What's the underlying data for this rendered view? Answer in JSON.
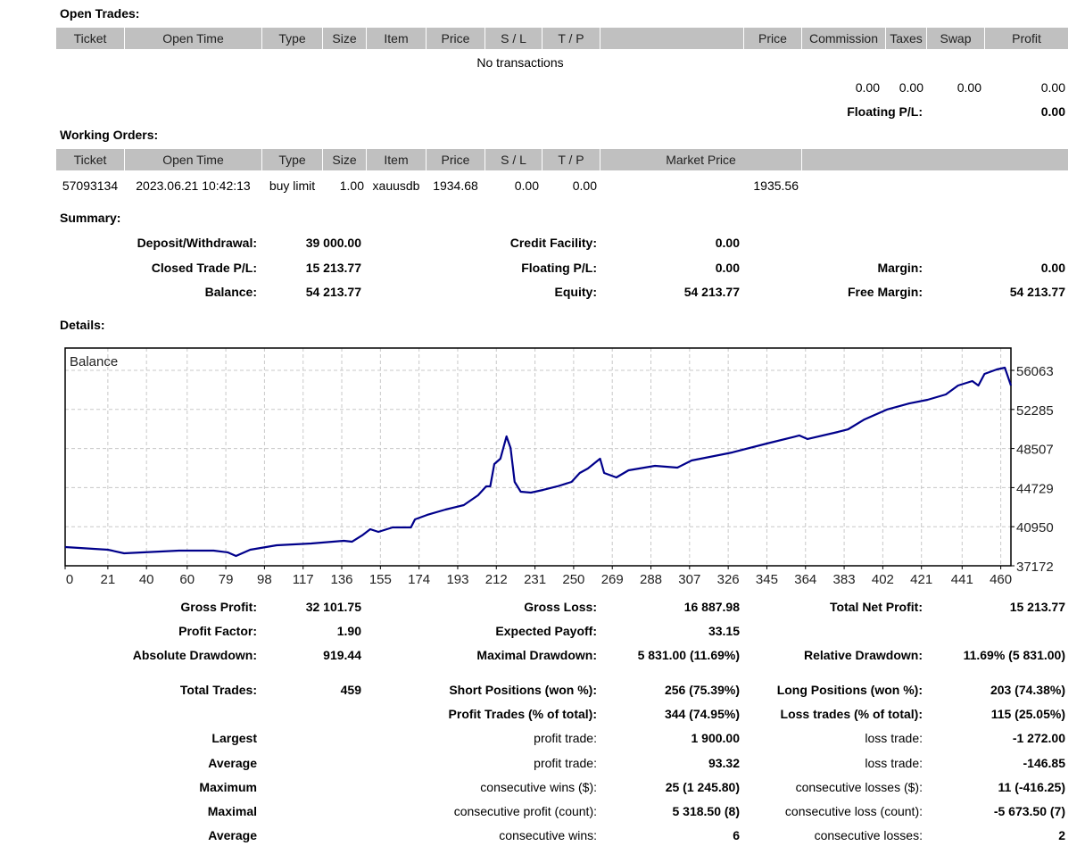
{
  "open_trades": {
    "title": "Open Trades:",
    "headers": [
      "Ticket",
      "Open Time",
      "Type",
      "Size",
      "Item",
      "Price",
      "S / L",
      "T / P",
      "",
      "Price",
      "Commission",
      "Taxes",
      "Swap",
      "Profit"
    ],
    "empty_text": "No transactions",
    "totals": {
      "commission": "0.00",
      "taxes": "0.00",
      "swap": "0.00",
      "profit": "0.00"
    },
    "floating_label": "Floating P/L:",
    "floating_value": "0.00"
  },
  "working_orders": {
    "title": "Working Orders:",
    "headers": [
      "Ticket",
      "Open Time",
      "Type",
      "Size",
      "Item",
      "Price",
      "S / L",
      "T / P",
      "Market Price",
      ""
    ],
    "rows": [
      [
        "57093134",
        "2023.06.21 10:42:13",
        "buy limit",
        "1.00",
        "xauusdb",
        "1934.68",
        "0.00",
        "0.00",
        "1935.56"
      ]
    ]
  },
  "summary": {
    "title": "Summary:",
    "rows": [
      [
        "Deposit/Withdrawal:",
        "39 000.00",
        "Credit Facility:",
        "0.00",
        "",
        ""
      ],
      [
        "Closed Trade P/L:",
        "15 213.77",
        "Floating P/L:",
        "0.00",
        "Margin:",
        "0.00"
      ],
      [
        "Balance:",
        "54 213.77",
        "Equity:",
        "54 213.77",
        "Free Margin:",
        "54 213.77"
      ]
    ]
  },
  "details": {
    "title": "Details:",
    "rows": [
      [
        "Gross Profit:",
        "32 101.75",
        "Gross Loss:",
        "16 887.98",
        "Total Net Profit:",
        "15 213.77"
      ],
      [
        "Profit Factor:",
        "1.90",
        "Expected Payoff:",
        "33.15",
        "",
        ""
      ],
      [
        "Absolute Drawdown:",
        "919.44",
        "Maximal Drawdown:",
        "5 831.00 (11.69%)",
        "Relative Drawdown:",
        "11.69% (5 831.00)"
      ],
      [
        "Total Trades:",
        "459",
        "Short Positions (won %):",
        "256 (75.39%)",
        "Long Positions (won %):",
        "203 (74.38%)"
      ],
      [
        "",
        "",
        "Profit Trades (% of total):",
        "344 (74.95%)",
        "Loss trades (% of total):",
        "115 (25.05%)"
      ],
      [
        "Largest",
        "",
        "profit trade:",
        "1 900.00",
        "loss trade:",
        "-1 272.00"
      ],
      [
        "Average",
        "",
        "profit trade:",
        "93.32",
        "loss trade:",
        "-146.85"
      ],
      [
        "Maximum",
        "",
        "consecutive wins ($):",
        "25 (1 245.80)",
        "consecutive losses ($):",
        "11 (-416.25)"
      ],
      [
        "Maximal",
        "",
        "consecutive profit (count):",
        "5 318.50 (8)",
        "consecutive loss (count):",
        "-5 673.50 (7)"
      ],
      [
        "Average",
        "",
        "consecutive wins:",
        "6",
        "consecutive losses:",
        "2"
      ]
    ]
  },
  "chart_data": {
    "type": "line",
    "title": "Balance",
    "xlim": [
      0,
      465
    ],
    "ylim": [
      37172,
      58220
    ],
    "grid": true,
    "x_ticks": [
      0,
      21,
      40,
      60,
      79,
      98,
      117,
      136,
      155,
      174,
      193,
      212,
      231,
      250,
      269,
      288,
      307,
      326,
      345,
      364,
      383,
      402,
      421,
      441,
      460
    ],
    "y_ticks": [
      37172,
      40950,
      44729,
      48507,
      52285,
      56063
    ],
    "line_color": "#00008b",
    "series": [
      {
        "x": [
          0,
          21,
          29,
          56,
          73,
          80,
          84,
          91,
          104,
          121,
          137,
          141,
          146,
          150,
          154,
          161,
          170,
          172,
          178,
          187,
          196,
          203,
          207,
          209,
          211,
          214,
          217,
          219,
          221,
          224,
          229,
          235,
          242,
          249,
          253,
          257,
          263,
          265,
          271,
          277,
          290,
          301,
          308,
          328,
          345,
          361,
          365,
          380,
          385,
          393,
          404,
          415,
          424,
          433,
          439,
          446,
          449,
          452,
          458,
          462,
          465
        ],
        "y": [
          38983,
          38725,
          38380,
          38640,
          38640,
          38466,
          38120,
          38725,
          39156,
          39329,
          39588,
          39500,
          40105,
          40709,
          40450,
          40881,
          40881,
          41657,
          42090,
          42607,
          43038,
          43987,
          44850,
          44850,
          47007,
          47524,
          49681,
          48559,
          45281,
          44332,
          44246,
          44505,
          44850,
          45281,
          46144,
          46575,
          47524,
          46144,
          45713,
          46403,
          46834,
          46661,
          47351,
          48128,
          48990,
          49767,
          49422,
          50112,
          50370,
          51320,
          52270,
          52870,
          53217,
          53734,
          54597,
          55028,
          54597,
          55718,
          56150,
          56322,
          54597
        ]
      }
    ]
  }
}
